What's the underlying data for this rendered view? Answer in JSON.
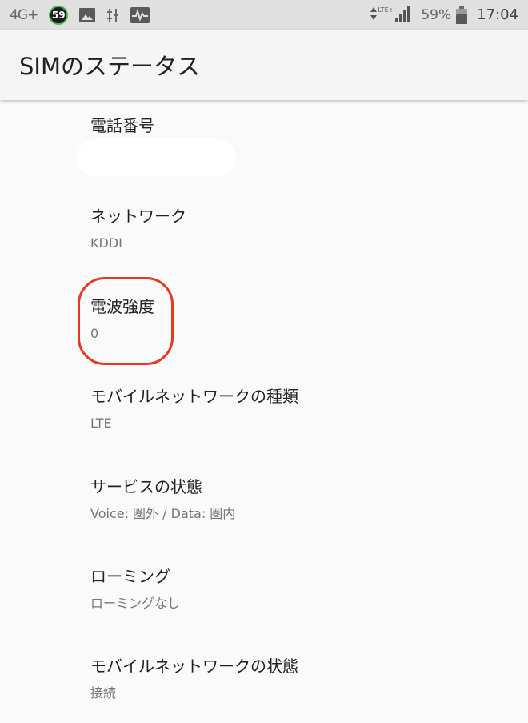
{
  "status_bar": {
    "left_text": "4G+",
    "badge": "59",
    "battery_percent": "59%",
    "clock": "17:04",
    "network_type": "LTE+",
    "icons": [
      "image-icon",
      "usb-debug-icon",
      "pulse-icon",
      "data-arrows-icon",
      "signal-icon",
      "battery-icon"
    ]
  },
  "app_bar": {
    "title": "SIMのステータス"
  },
  "items": [
    {
      "title": "電話番号",
      "summary": ""
    },
    {
      "title": "ネットワーク",
      "summary": "KDDI"
    },
    {
      "title": "電波強度",
      "summary": "0"
    },
    {
      "title": "モバイルネットワークの種類",
      "summary": "LTE"
    },
    {
      "title": "サービスの状態",
      "summary": "Voice: 圏外 / Data: 圏内"
    },
    {
      "title": "ローミング",
      "summary": "ローミングなし"
    },
    {
      "title": "モバイルネットワークの状態",
      "summary": "接続"
    }
  ],
  "colors": {
    "highlight": "#e8391f",
    "status_bar_bg": "#e0e0e0",
    "background": "#fafafa"
  }
}
